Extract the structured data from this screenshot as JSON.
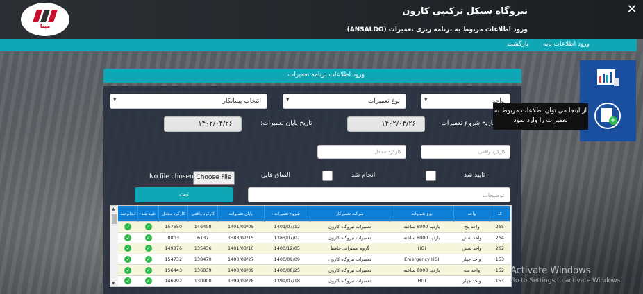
{
  "header": {
    "title": "نیروگاه سیکل ترکیبی کارون",
    "subtitle": "ورود اطلاعات مربوط به برنامه ریزی تعمیرات (ANSALDO)",
    "logo_text": "مپنا"
  },
  "nav": {
    "items": [
      {
        "label": "ورود اطلاعات پایه"
      },
      {
        "label": "بازگشت"
      }
    ]
  },
  "panel": {
    "title": "ورود اطلاعات برنامه تعمیرات"
  },
  "form": {
    "unit_select": "واحد",
    "repair_type_select": "نوع تعمیرات",
    "contractor_select": "انتخاب پیمانکار",
    "start_date_label": "تاریخ شروع تعمیرات",
    "start_date_value": "۱۴۰۲/۰۴/۲۶",
    "end_date_label": "تاریخ پایان تعمیرات:",
    "end_date_value": "۱۴۰۲/۰۴/۲۶",
    "actual_perf_placeholder": "کارکرد واقعی",
    "equiv_perf_placeholder": "کارکرد معادل",
    "approved_label": "تایید شد",
    "done_label": "انجام شد",
    "attach_label": "الصاق فایل",
    "file_button": "Choose File",
    "no_file": "No file chosen",
    "save_button": "ثبت",
    "notes_placeholder": "توضیحات"
  },
  "table": {
    "headers": [
      "کد",
      "واحد",
      "نوع تعمیرات",
      "شرکت تعمیرکار",
      "شروع تعمیرات",
      "پایان تعمیرات",
      "کارکرد واقعی",
      "کارکرد معادل",
      "تایید شد",
      "انجام شد"
    ],
    "rows": [
      {
        "code": "265",
        "unit": "واحد پنج",
        "type": "بازدید 8000 ساعته",
        "company": "تعمیرات نیروگاه کارون",
        "start": "1401/07/12",
        "end": "1401/09/05",
        "actual": "146408",
        "equiv": "157650"
      },
      {
        "code": "264",
        "unit": "واحد شش",
        "type": "بازدید 8000 ساعته",
        "company": "تعمیرات نیروگاه کارون",
        "start": "1383/07/07",
        "end": "1383/07/15",
        "actual": "6137",
        "equiv": "8003"
      },
      {
        "code": "262",
        "unit": "واحد شش",
        "type": "HGI",
        "company": "گروه تعمیراتی حافظ",
        "start": "1400/12/05",
        "end": "1401/03/10",
        "actual": "135436",
        "equiv": "149876"
      },
      {
        "code": "153",
        "unit": "واحد چهار",
        "type": "Emergency HGI",
        "company": "تعمیرات نیروگاه کارون",
        "start": "1400/09/09",
        "end": "1400/09/27",
        "actual": "138470",
        "equiv": "154732"
      },
      {
        "code": "152",
        "unit": "واحد سه",
        "type": "بازدید 8000 ساعته",
        "company": "تعمیرات نیروگاه کارون",
        "start": "1400/08/25",
        "end": "1400/09/09",
        "actual": "136839",
        "equiv": "156443"
      },
      {
        "code": "151",
        "unit": "واحد چهار",
        "type": "HGI",
        "company": "تعمیرات نیروگاه کارون",
        "start": "1399/07/18",
        "end": "1399/09/28",
        "actual": "130900",
        "equiv": "146992"
      }
    ]
  },
  "sidebar": {
    "tooltip": "از اینجا می توان اطلاعات مربوط به تعمیرات را وارد نمود"
  },
  "watermark": {
    "line1": "Activate Windows",
    "line2": "Go to Settings to activate Windows."
  },
  "colors": {
    "accent": "#0fa7b5",
    "table_header": "#0d7fd6",
    "ok_green": "#2eb84a"
  }
}
